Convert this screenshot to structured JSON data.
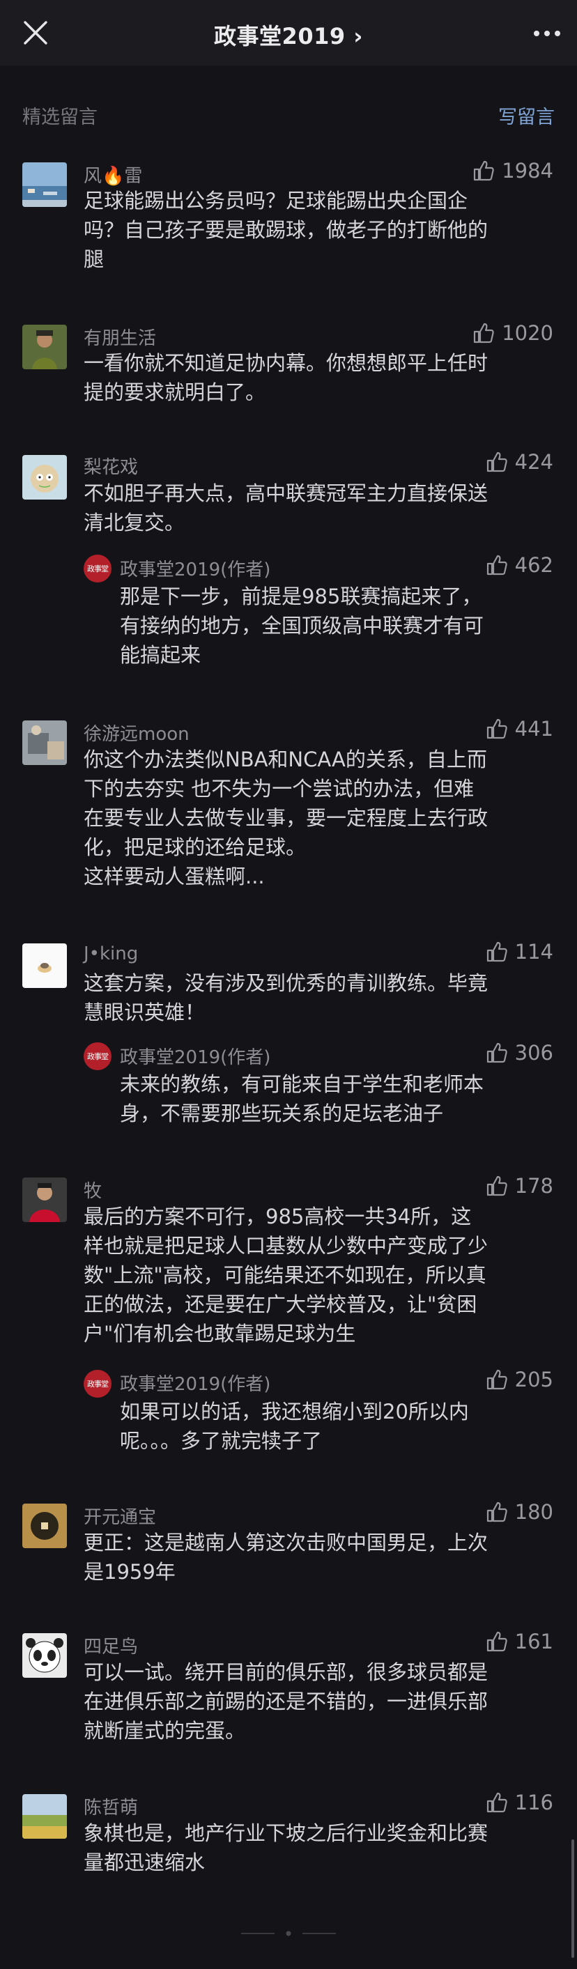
{
  "nav": {
    "title": "政事堂2019 ›"
  },
  "section": {
    "label": "精选留言",
    "write": "写留言"
  },
  "comments": [
    {
      "nick": "风🔥雷",
      "likes": "1984",
      "text": "足球能踢出公务员吗？足球能踢出央企国企\n吗？自己孩子要是敢踢球，做老子的打断他的\n腿"
    },
    {
      "nick": "有朋生活",
      "likes": "1020",
      "text": "一看你就不知道足协内幕。你想想郎平上任时\n提的要求就明白了。"
    },
    {
      "nick": "梨花戏",
      "likes": "424",
      "text": "不如胆子再大点，高中联赛冠军主力直接保送\n清北复交。",
      "reply": {
        "nick": "政事堂2019(作者)",
        "likes": "462",
        "text": "那是下一步，前提是985联赛搞起来了，\n有接纳的地方，全国顶级高中联赛才有可\n能搞起来"
      }
    },
    {
      "nick": "徐游远moon",
      "likes": "441",
      "text": "你这个办法类似NBA和NCAA的关系，自上而\n下的去夯实 也不失为一个尝试的办法，但难\n在要专业人去做专业事，要一定程度上去行政\n化，把足球的还给足球。\n这样要动人蛋糕啊..."
    },
    {
      "nick": "J•king",
      "likes": "114",
      "text": "这套方案，没有涉及到优秀的青训教练。毕竟\n慧眼识英雄！",
      "reply": {
        "nick": "政事堂2019(作者)",
        "likes": "306",
        "text": "未来的教练，有可能来自于学生和老师本\n身，不需要那些玩关系的足坛老油子"
      }
    },
    {
      "nick": "牧",
      "likes": "178",
      "text": "最后的方案不可行，985高校一共34所，这\n样也就是把足球人口基数从少数中产变成了少\n数\"上流\"高校，可能结果还不如现在，所以真\n正的做法，还是要在广大学校普及，让\"贫困\n户\"们有机会也敢靠踢足球为生",
      "reply": {
        "nick": "政事堂2019(作者)",
        "likes": "205",
        "text": "如果可以的话，我还想缩小到20所以内\n呢。。。多了就完犊子了"
      }
    },
    {
      "nick": "开元通宝",
      "likes": "180",
      "text": "更正：这是越南人第这次击败中国男足，上次\n是1959年"
    },
    {
      "nick": "四足鸟",
      "likes": "161",
      "text": "可以一试。绕开目前的俱乐部，很多球员都是\n在进俱乐部之前踢的还是不错的，一进俱乐部\n就断崖式的完蛋。"
    },
    {
      "nick": "陈哲萌",
      "likes": "116",
      "text": "象棋也是，地产行业下坡之后行业奖金和比赛\n量都迅速缩水"
    }
  ],
  "author_avatar_text": "政事堂",
  "colors": {
    "background": "#141318",
    "topbar": "#1c1b20",
    "link": "#7fa4d6",
    "author_badge": "#b3202a"
  }
}
